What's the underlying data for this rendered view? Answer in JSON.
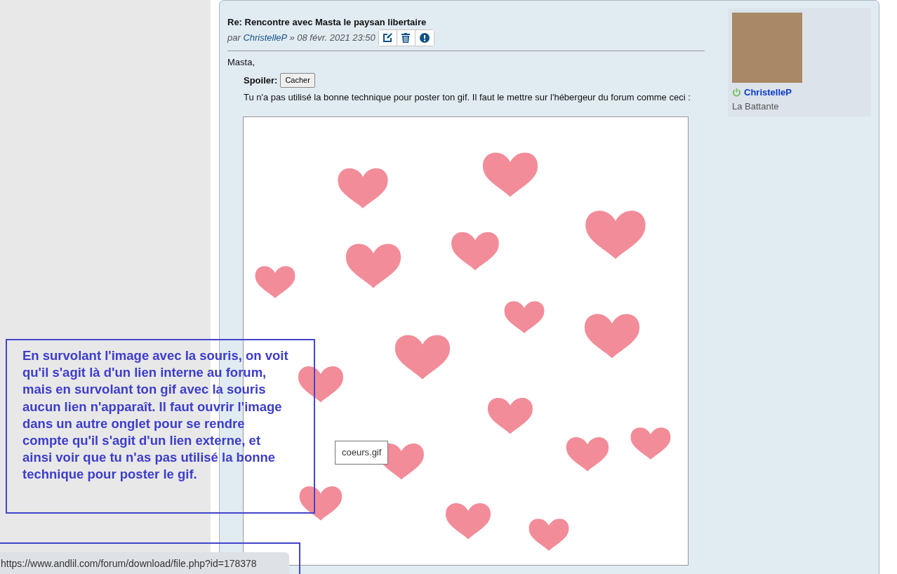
{
  "post": {
    "title": "Re: Rencontre avec Masta le paysan libertaire",
    "byline_prefix": "par",
    "author": "ChristelleP",
    "date": "» 08 févr. 2021 23:50",
    "actions": [
      {
        "kind": "edit"
      },
      {
        "kind": "delete"
      },
      {
        "kind": "report"
      }
    ],
    "greeting": "Masta,",
    "spoiler": {
      "label": "Spoiler:",
      "button": "Cacher",
      "text": "Tu n'a pas utilisé la bonne technique pour poster ton gif. Il faut le mettre sur l'hébergeur du forum comme ceci :"
    },
    "image": {
      "tooltip": "coeurs.gif"
    }
  },
  "profile": {
    "username": "ChristelleP",
    "online": true,
    "rank": "La Battante"
  },
  "annotation": {
    "text": "En survolant l'image avec la souris, on voit qu'il s'agit là d'un lien interne au forum, mais  en survolant ton gif avec la souris aucun lien n'apparaît. Il faut ouvrir l'image dans un autre onglet pour se rendre compte qu'il s'agit d'un lien externe, et ainsi voir que tu n'as pas utilisé  la  bonne technique pour poster le gif."
  },
  "status_bar": {
    "url": "https://www.andlil.com/forum/download/file.php?id=178378"
  }
}
